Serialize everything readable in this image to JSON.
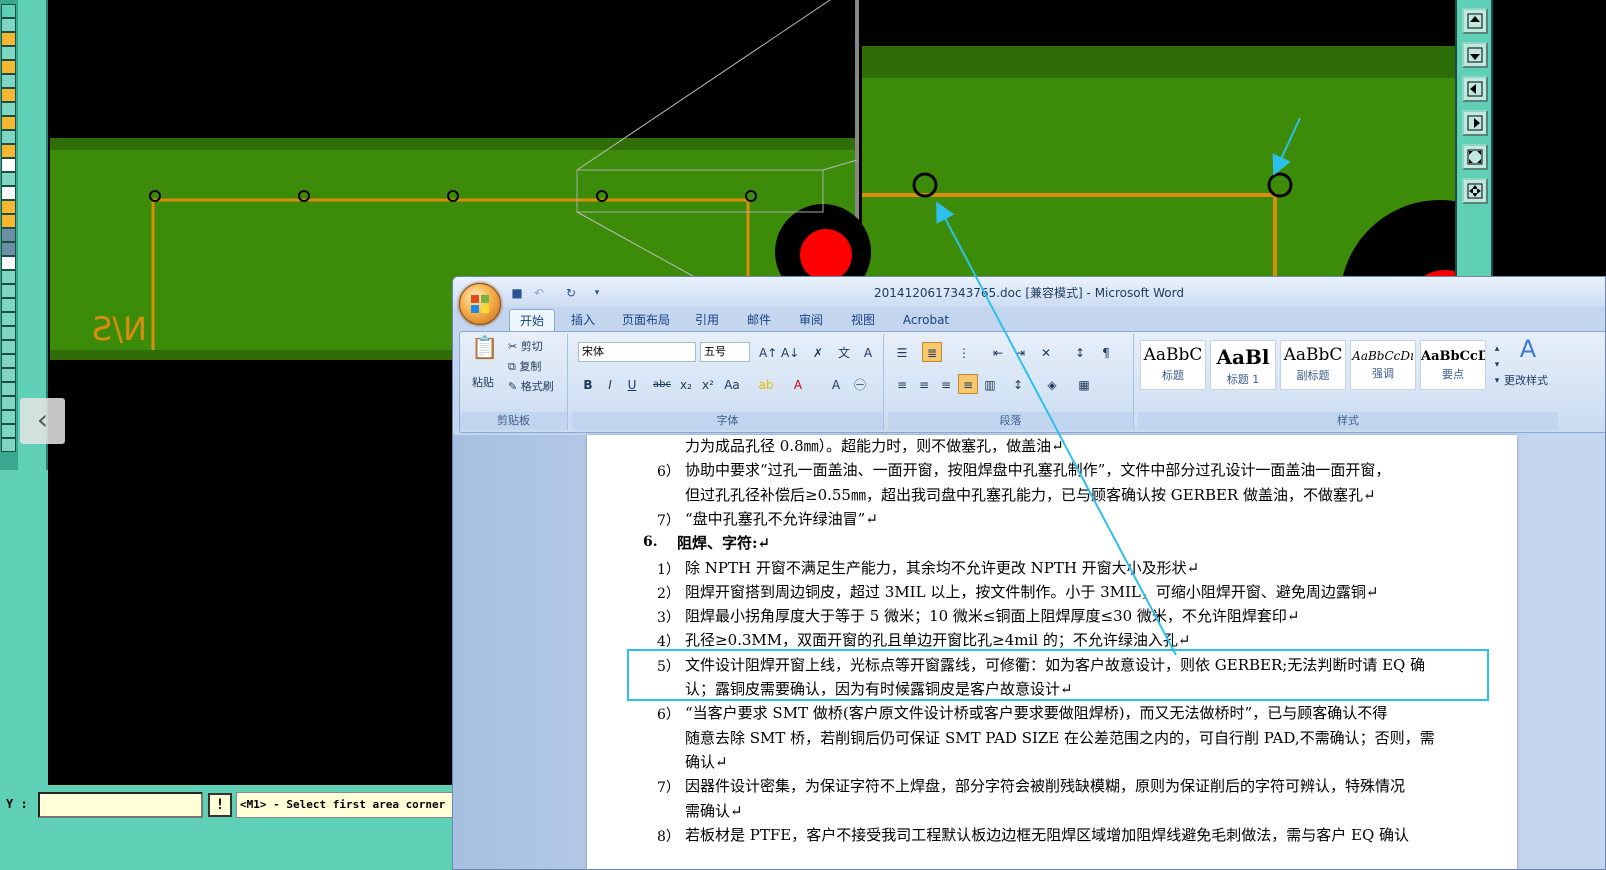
{
  "cam": {
    "silkscreen_text": "N/S",
    "y_label": "Y :",
    "y_value": "",
    "warn_symbol": "!",
    "status_message": "<M1> - Select first area corner",
    "nav_prev_symbol": "‹",
    "colors": {
      "board": "#3c8c0a",
      "trace": "#d98d0c",
      "panel": "#5fcfb5",
      "pad": "#ff0000",
      "annotation": "#2ec0ec"
    },
    "toolbar_icons": [
      "move-up-icon",
      "move-down-icon",
      "move-left-icon",
      "move-right-icon",
      "fit-icon",
      "center-icon"
    ]
  },
  "word": {
    "title": "20141206173437​65.doc [兼容模式] - Microsoft Word",
    "tabs": [
      "开始",
      "插入",
      "页面布局",
      "引用",
      "邮件",
      "审阅",
      "视图",
      "Acrobat"
    ],
    "active_tab": "开始",
    "clipboard": {
      "paste": "粘贴",
      "cut": "剪切",
      "copy": "复制",
      "format_painter": "格式刷",
      "group": "剪贴板"
    },
    "font": {
      "name": "宋体",
      "size": "五号",
      "group": "字体"
    },
    "paragraph": {
      "group": "段落"
    },
    "styles": {
      "group": "样式",
      "change_styles": "更改样式",
      "items": [
        {
          "preview": "AaBbC",
          "name": "标题"
        },
        {
          "preview": "AaBl",
          "name": "标题 1"
        },
        {
          "preview": "AaBbC",
          "name": "副标题"
        },
        {
          "preview": "AaBbCcDı",
          "name": "强调"
        },
        {
          "preview": "AaBbCcD",
          "name": "要点"
        }
      ]
    }
  },
  "doc": {
    "lines": [
      {
        "num": "",
        "text": "力为成品孔径 0.8㎜）。超能力时，则不做塞孔，做盖油↵"
      },
      {
        "num": "6）",
        "text": "协助中要求“过孔一面盖油、一面开窗，按阻焊盘中孔塞孔制作”，文件中部分过孔设计一面盖油一面开窗，"
      },
      {
        "num": "",
        "text": "但过孔孔径补偿后≥0.55㎜，超出我司盘中孔塞孔能力，已与顾客确认按 GERBER 做盖油，不做塞孔↵"
      },
      {
        "num": "7）",
        "text": "“盘中孔塞孔不允许绿油冒”↵"
      },
      {
        "num": "6.",
        "text": "阻焊、字符:↵",
        "heading": true
      },
      {
        "num": "1）",
        "text": "除 NPTH 开窗不满足生产能力，其余均不允许更改 NPTH 开窗大小及形状↵"
      },
      {
        "num": "2）",
        "text": "阻焊开窗搭到周边铜皮，超过 3MIL 以上，按文件制作。小于 3MIL，可缩小阻焊开窗、避免周边露铜↵"
      },
      {
        "num": "3）",
        "text": "阻焊最小拐角厚度大于等于 5 微米；10 微米≤铜面上阻焊厚度≤30 微米，不允许阻焊套印↵"
      },
      {
        "num": "4）",
        "text": "孔径≥0.3MM，双面开窗的孔且单边开窗比孔≥4mil 的；不允许绿油入孔↵"
      },
      {
        "num": "5）",
        "text": "文件设计阻焊开窗上线，光标点等开窗露线，可修衢：如为客户故意设计，则依 GERBER;无法判断时请 EQ 确"
      },
      {
        "num": "",
        "text": "认；露铜皮需要确认，因为有时候露铜皮是客户故意设计↵"
      },
      {
        "num": "6）",
        "text": "“当客户要求 SMT 做桥(客户原文件设计桥或客户要求要做阻焊桥)，而又无法做桥时”，已与顾客确认不得"
      },
      {
        "num": "",
        "text": "随意去除 SMT 桥，若削铜后仍可保证 SMT PAD SIZE 在公差范围之内的，可自行削 PAD,不需确认；否则，需"
      },
      {
        "num": "",
        "text": "确认↵"
      },
      {
        "num": "7）",
        "text": "因器件设计密集，为保证字符不上焊盘，部分字符会被削残缺模糊，原则为保证削后的字符可辨认，特殊情况"
      },
      {
        "num": "",
        "text": "需确认↵"
      },
      {
        "num": "8）",
        "text": "若板材是 PTFE，客户不接受我司工程默认板边边框无阻焊区域增加阻焊线避免毛刺做法，需与客户 EQ 确认"
      }
    ]
  }
}
